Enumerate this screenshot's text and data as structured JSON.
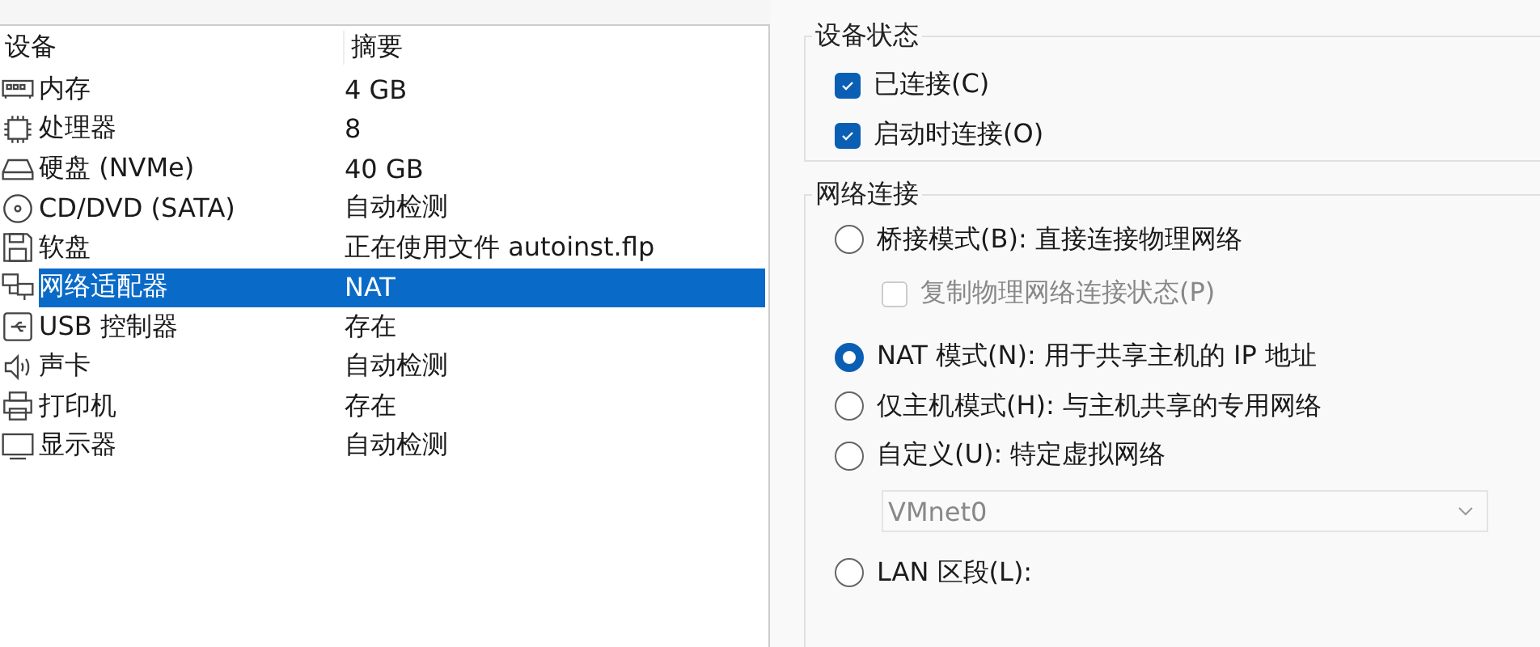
{
  "device_table": {
    "columns": [
      "设备",
      "摘要"
    ],
    "rows": [
      {
        "device": "内存",
        "summary": "4 GB",
        "selected": false
      },
      {
        "device": "处理器",
        "summary": "8",
        "selected": false
      },
      {
        "device": "硬盘 (NVMe)",
        "summary": "40 GB",
        "selected": false
      },
      {
        "device": "CD/DVD (SATA)",
        "summary": "自动检测",
        "selected": false
      },
      {
        "device": "软盘",
        "summary": "正在使用文件 autoinst.flp",
        "selected": false
      },
      {
        "device": "网络适配器",
        "summary": "NAT",
        "selected": true
      },
      {
        "device": "USB 控制器",
        "summary": "存在",
        "selected": false
      },
      {
        "device": "声卡",
        "summary": "自动检测",
        "selected": false
      },
      {
        "device": "打印机",
        "summary": "存在",
        "selected": false
      },
      {
        "device": "显示器",
        "summary": "自动检测",
        "selected": false
      }
    ]
  },
  "device_status": {
    "title": "设备状态",
    "options": [
      {
        "label": "已连接(C)",
        "checked": true
      },
      {
        "label": "启动时连接(O)",
        "checked": true
      }
    ]
  },
  "network_connection": {
    "title": "网络连接",
    "options": [
      {
        "kind": "radio",
        "label": "桥接模式(B): 直接连接物理网络",
        "selected": false
      },
      {
        "kind": "checkbox",
        "label": "复制物理网络连接状态(P)",
        "checked": false,
        "disabled": true
      },
      {
        "kind": "radio",
        "label": "NAT 模式(N): 用于共享主机的 IP 地址",
        "selected": true
      },
      {
        "kind": "radio",
        "label": "仅主机模式(H): 与主机共享的专用网络",
        "selected": false
      },
      {
        "kind": "radio",
        "label": "自定义(U): 特定虚拟网络",
        "selected": false
      },
      {
        "kind": "select",
        "value": "VMnet0",
        "disabled": true
      },
      {
        "kind": "radio",
        "label": "LAN 区段(L):",
        "selected": false
      }
    ]
  }
}
